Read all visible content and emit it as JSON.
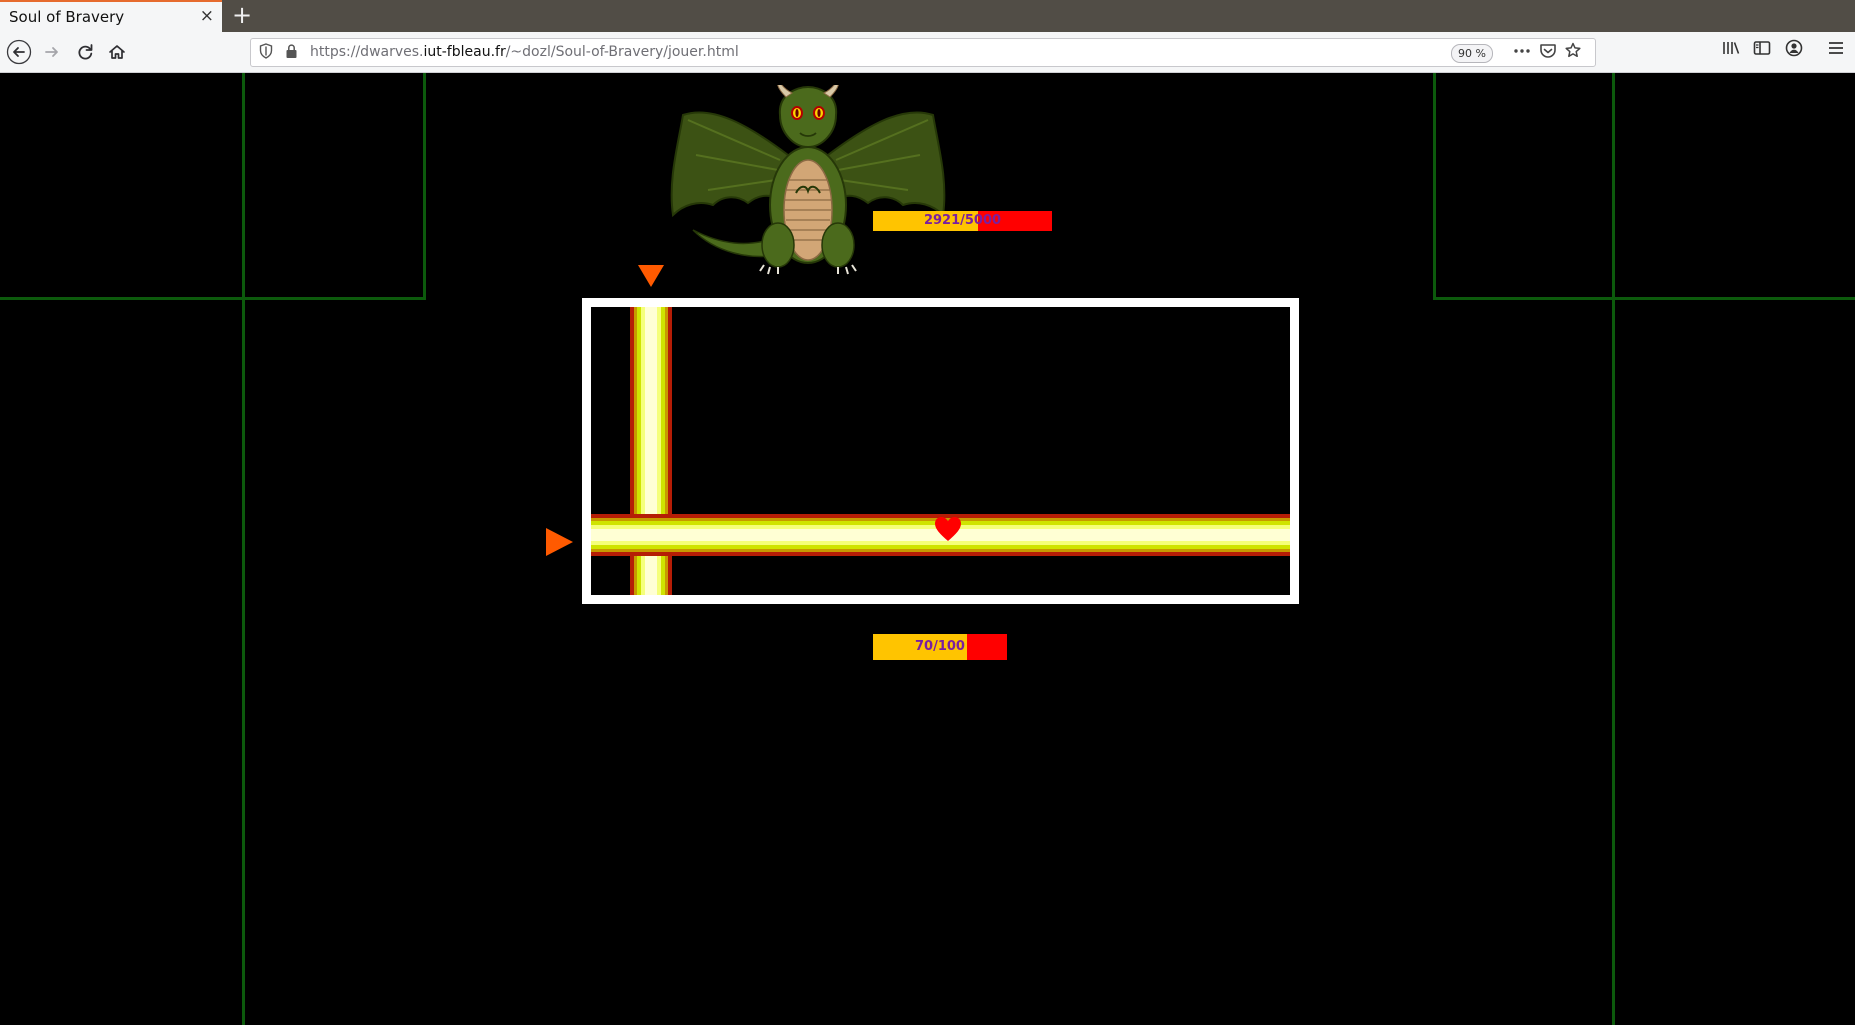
{
  "browser": {
    "tab_title": "Soul of Bravery",
    "tab_close": "×",
    "new_tab": "+",
    "url_prefix": "https://dwarves.",
    "url_host": "iut-fbleau.fr",
    "url_path": "/~dozl/Soul-of-Bravery/jouer.html",
    "zoom": "90 %",
    "icons": [
      "back-icon",
      "forward-icon",
      "reload-icon",
      "home-icon",
      "shield-icon",
      "lock-icon",
      "more-icon",
      "pocket-icon",
      "bookmark-star-icon",
      "library-icon",
      "sidebar-icon",
      "account-icon",
      "menu-icon"
    ]
  },
  "game": {
    "boss_hp": {
      "current": 2921,
      "max": 5000,
      "label": "2921/5000"
    },
    "player_hp": {
      "current": 70,
      "max": 100,
      "label": "70/100"
    },
    "colors": {
      "background": "#000000",
      "grid": "#0c5a0c",
      "arena_border": "#ffffff",
      "hp_fill": "#ffc400",
      "hp_empty": "#ff0000",
      "hp_text": "#7a1fa0",
      "warning_arrow": "#ff5a00",
      "heart": "#ff0000"
    }
  }
}
